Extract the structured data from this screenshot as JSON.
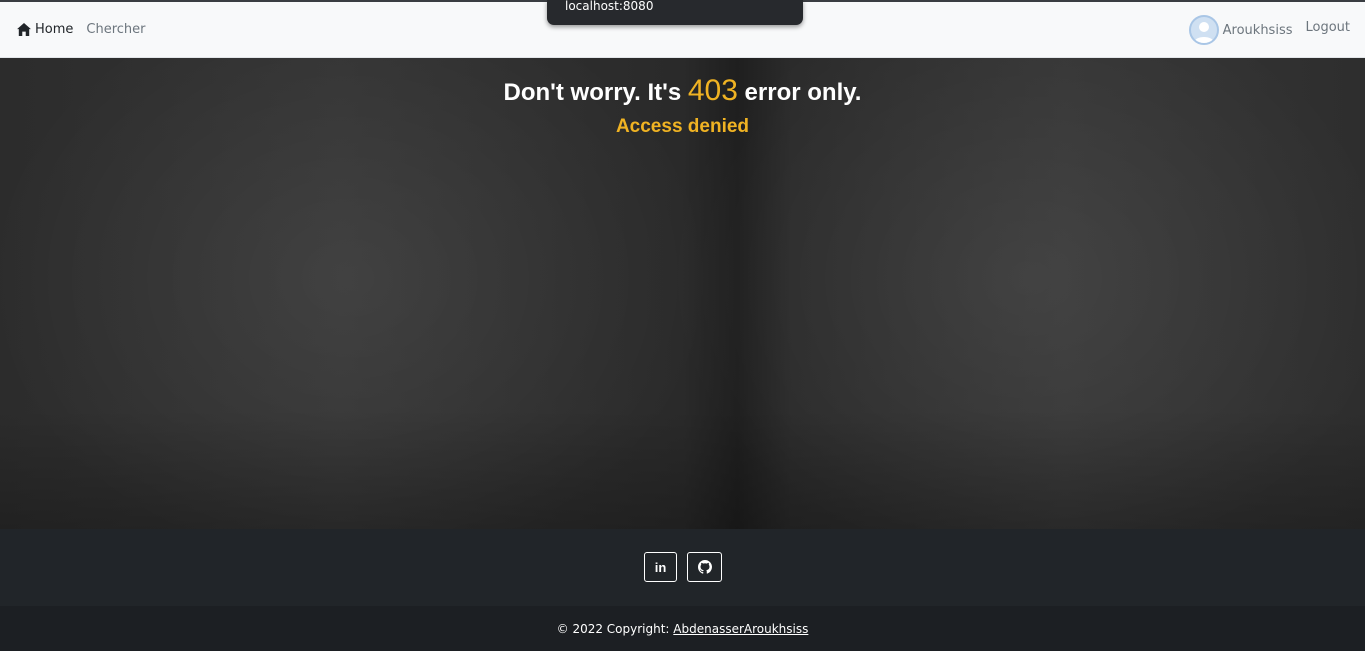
{
  "browser": {
    "url_hover": "localhost:8080"
  },
  "navbar": {
    "home_icon": "home-icon",
    "home_label": "Home",
    "search_label": "Chercher",
    "avatar_icon": "user-avatar-icon",
    "username": "Aroukhsiss",
    "logout_label": "Logout"
  },
  "error": {
    "headline_prefix": "Don't worry. It's ",
    "code": "403",
    "headline_suffix": " error only.",
    "subtitle": "Access denied"
  },
  "footer": {
    "social": [
      {
        "name": "LinkedIn",
        "icon": "linkedin-icon",
        "glyph": "in"
      },
      {
        "name": "GitHub",
        "icon": "github-icon"
      }
    ],
    "copyright_prefix": "© 2022 Copyright: ",
    "copyright_link": "AbdenasserAroukhsiss"
  },
  "colors": {
    "accent": "#f0b323",
    "navbar_bg": "#f8f9fa",
    "footer_bg": "#212529",
    "footer_bottom_bg": "#1c1f23"
  }
}
